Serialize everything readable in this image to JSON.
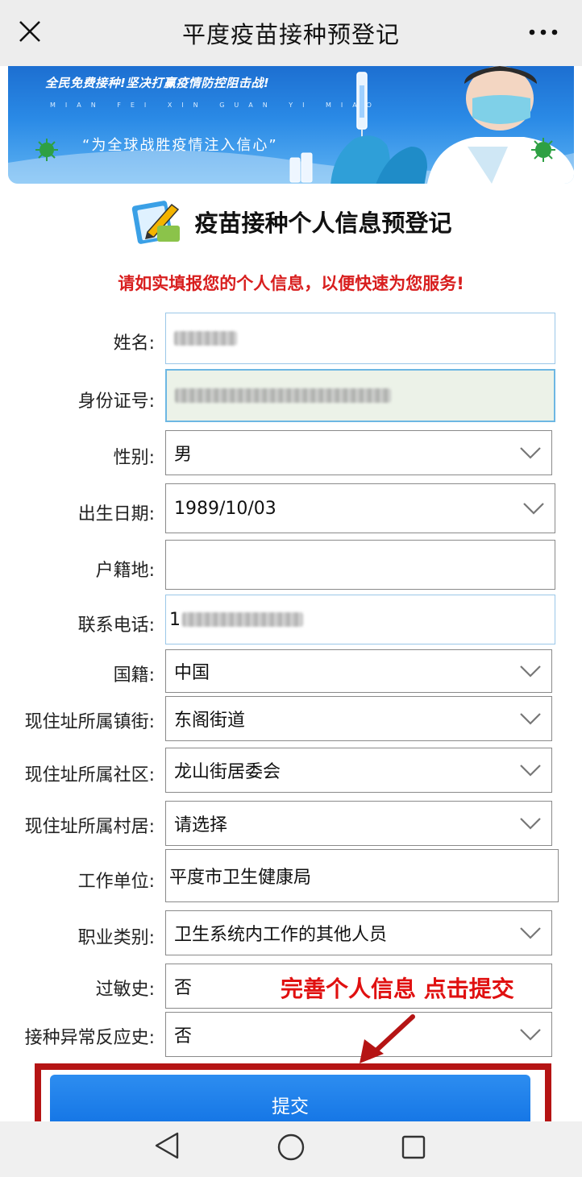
{
  "navbar": {
    "title": "平度疫苗接种预登记",
    "close_icon": "close-icon",
    "more_icon": "more-icon"
  },
  "banner": {
    "slogan": "全民免费接种!坚决打赢疫情防控阻击战!",
    "pinyin": "MIAN FEI XIN GUAN YI MIAO",
    "quote": "“为全球战胜疫情注入信心”"
  },
  "heading": {
    "title": "疫苗接种个人信息预登记",
    "icon": "edit-form-icon"
  },
  "notice": "请如实填报您的个人信息，以便快速为您服务!",
  "form": {
    "name": {
      "label": "姓名:"
    },
    "id_number": {
      "label": "身份证号:"
    },
    "gender": {
      "label": "性别:",
      "value": "男"
    },
    "birth_date": {
      "label": "出生日期:",
      "value": "1989/10/03"
    },
    "household": {
      "label": "户籍地:",
      "value": ""
    },
    "phone": {
      "label": "联系电话:",
      "value_prefix": "1"
    },
    "nationality": {
      "label": "国籍:",
      "value": "中国"
    },
    "town": {
      "label": "现住址所属镇街:",
      "value": "东阁街道"
    },
    "community": {
      "label": "现住址所属社区:",
      "value": "龙山街居委会"
    },
    "village": {
      "label": "现住址所属村居:",
      "value": "请选择"
    },
    "employer": {
      "label": "工作单位:",
      "value": "平度市卫生健康局"
    },
    "occupation": {
      "label": "职业类别:",
      "value": "卫生系统内工作的其他人员"
    },
    "allergy": {
      "label": "过敏史:",
      "value": "否"
    },
    "adverse_reaction": {
      "label": "接种异常反应史:",
      "value": "否"
    }
  },
  "annotation": "完善个人信息 点击提交",
  "submit_label": "提交",
  "system_nav": {
    "back_icon": "back-triangle-icon",
    "home_icon": "home-circle-icon",
    "recent_icon": "recent-square-icon"
  },
  "colors": {
    "notice_red": "#d81e1e",
    "annotation_red": "#e01010",
    "submit_blue": "#1677e6",
    "highlight_border": "#b51414"
  }
}
